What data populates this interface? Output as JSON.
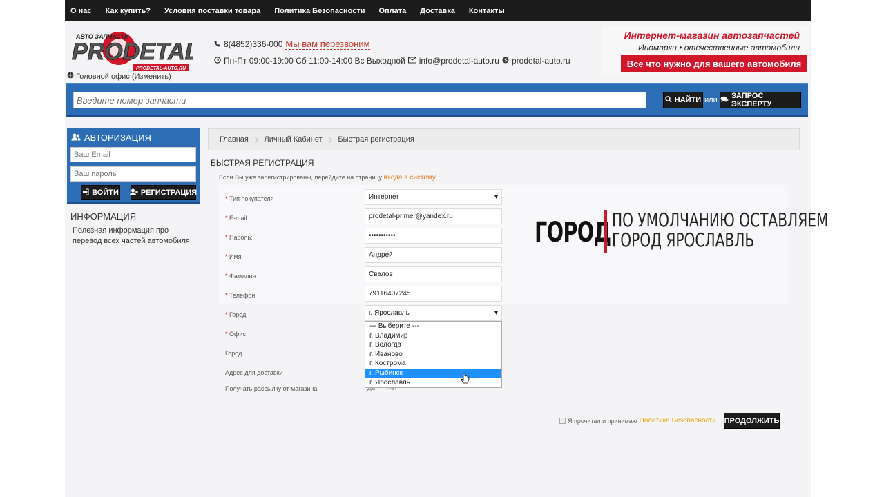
{
  "nav": {
    "items": [
      "О нас",
      "Как купить?",
      "Условия поставки товара",
      "Политика Безопасности",
      "Оплата",
      "Доставка",
      "Контакты"
    ]
  },
  "header": {
    "logo_top": "АВТО ЗАПЧАСТИ",
    "logo_main": "PRODETAL",
    "logo_sub": "PRODETAL-AUTO.RU",
    "office": "Головной офис (Изменить)",
    "phone": "8(4852)336-000",
    "callback": "Мы вам перезвоним",
    "hours": "Пн-Пт 09:00-19:00 Сб 11:00-14:00 Вс Выходной",
    "email": "info@prodetal-auto.ru",
    "skype": "prodetal-auto.ru",
    "promo_title": "Интернет-магазин автозапчастей",
    "promo_sub": "Иномарки • отечественные автомобили",
    "promo_button": "Все что нужно для вашего автомобиля"
  },
  "search": {
    "placeholder": "Введите номер запчасти",
    "find": "НАЙТИ",
    "or": "или",
    "expert": "ЗАПРОС ЭКСПЕРТУ"
  },
  "auth": {
    "title": "АВТОРИЗАЦИЯ",
    "email_placeholder": "Ваш Email",
    "password_placeholder": "Ваш пароль",
    "login": "ВОЙТИ",
    "register": "РЕГИСТРАЦИЯ"
  },
  "info": {
    "title": "ИНФОРМАЦИЯ",
    "text": "Полезная информация про перевод всех частей автомобиля"
  },
  "breadcrumb": [
    "Главная",
    "Личный Кабинет",
    "Быстрая регистрация"
  ],
  "registration": {
    "title": "БЫСТРАЯ РЕГИСТРАЦИЯ",
    "note": "Если Вы уже зарегистрированы, перейдите на страницу",
    "login_link": "входа в систему.",
    "fields": {
      "buyer_type": {
        "label": "Тип покупателя",
        "value": "Интернет"
      },
      "email": {
        "label": "E-mail",
        "value": "prodetal-primer@yandex.ru"
      },
      "password": {
        "label": "Пароль:",
        "value": "•••••••••••"
      },
      "first_name": {
        "label": "Имя",
        "value": "Андрей"
      },
      "last_name": {
        "label": "Фамилия",
        "value": "Свалов"
      },
      "phone": {
        "label": "Телефон",
        "value": "79116407245"
      },
      "city": {
        "label": "Город",
        "value": "г. Ярославль"
      },
      "office": {
        "label": "Офис"
      },
      "city2": {
        "label": "Город"
      },
      "delivery_address": {
        "label": "Адрес для доставки"
      },
      "newsletter": {
        "label": "Получать рассылку от магазина",
        "yes": "Да",
        "no": "Нет"
      }
    },
    "city_options": [
      "--- Выберите ---",
      "г. Владимир",
      "г. Вологда",
      "г. Иваново",
      "г. Кострома",
      "г. Рыбинск",
      "г. Ярославль"
    ],
    "highlighted_option": "г. Рыбинск",
    "agree": "Я прочитал и принимаю",
    "policy_link": "Политика Безопасности",
    "continue": "ПРОДОЛЖИТЬ"
  },
  "overlay": {
    "word": "ГОРОД",
    "line1": "ПО УМОЛЧАНИЮ ОСТАВЛЯЕМ",
    "line2": "ГОРОД ЯРОСЛАВЛЬ"
  },
  "colors": {
    "brand_red": "#d0172b",
    "brand_blue": "#2d6db5",
    "nav_dark": "#1c1c1c",
    "highlight": "#1e90ff"
  }
}
